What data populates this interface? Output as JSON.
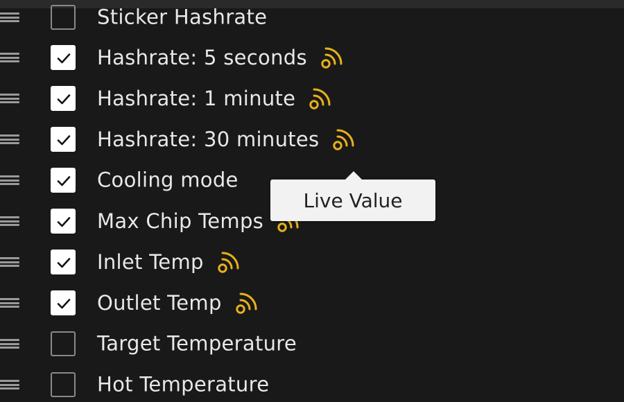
{
  "colors": {
    "background": "#191919",
    "live_accent": "#e8b11c",
    "checkbox_checked": "#ffffff"
  },
  "tooltip": {
    "text": "Live Value"
  },
  "items": [
    {
      "label": "Sticker Hashrate",
      "checked": false,
      "live": false
    },
    {
      "label": "Hashrate: 5 seconds",
      "checked": true,
      "live": true
    },
    {
      "label": "Hashrate: 1 minute",
      "checked": true,
      "live": true
    },
    {
      "label": "Hashrate: 30 minutes",
      "checked": true,
      "live": true
    },
    {
      "label": "Cooling mode",
      "checked": true,
      "live": false
    },
    {
      "label": "Max Chip Temps",
      "checked": true,
      "live": true
    },
    {
      "label": "Inlet Temp",
      "checked": true,
      "live": true
    },
    {
      "label": "Outlet Temp",
      "checked": true,
      "live": true
    },
    {
      "label": "Target Temperature",
      "checked": false,
      "live": false
    },
    {
      "label": "Hot Temperature",
      "checked": false,
      "live": false
    }
  ]
}
